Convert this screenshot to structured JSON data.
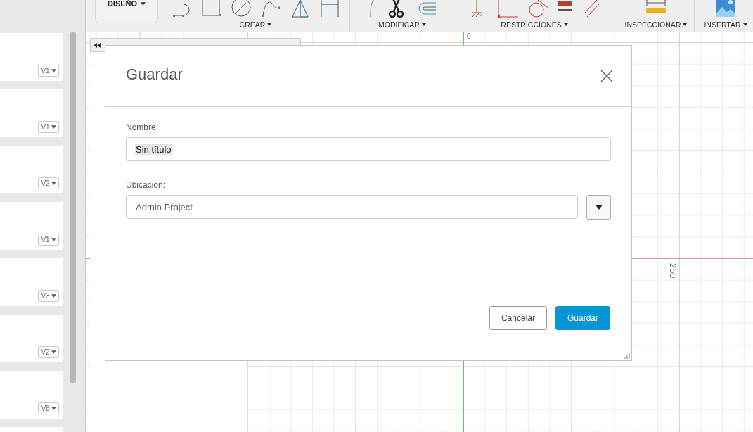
{
  "left_panel": {
    "cards": [
      {
        "kind": "full",
        "version": "V1"
      },
      {
        "kind": "full",
        "version": "V1"
      },
      {
        "kind": "full",
        "version": "V2"
      },
      {
        "kind": "full",
        "version": "V1"
      },
      {
        "kind": "full",
        "version": "V3"
      },
      {
        "kind": "full",
        "version": "V2"
      },
      {
        "kind": "full",
        "version": "V8"
      },
      {
        "kind": "cut"
      }
    ]
  },
  "toolbar": {
    "workspace": "DISEÑO",
    "groups": [
      {
        "kind": "create",
        "label": "CREAR"
      },
      {
        "kind": "modify",
        "label": "MODIFICAR"
      },
      {
        "kind": "constraints",
        "label": "RESTRICCIONES"
      },
      {
        "kind": "inspect",
        "label": "INSPECCIONAR"
      },
      {
        "kind": "insert",
        "label": "INSERTAR"
      }
    ]
  },
  "canvas": {
    "origin_label": "0",
    "dimension_label": "250"
  },
  "dialog": {
    "title": "Guardar",
    "fields": [
      {
        "kind": "text",
        "label": "Nombre:",
        "value": "Sin título",
        "text_selected": true
      },
      {
        "kind": "select",
        "label": "Ubicación:",
        "value": "Admin Project",
        "text_selected": false
      }
    ],
    "buttons": [
      {
        "kind": "secondary",
        "label": "Cancelar"
      },
      {
        "kind": "primary",
        "label": "Guardar"
      }
    ]
  }
}
